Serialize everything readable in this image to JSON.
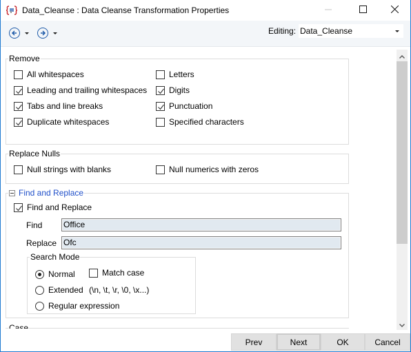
{
  "window": {
    "title": "Data_Cleanse : Data Cleanse Transformation Properties",
    "app_icon": "transform-icon",
    "controls": [
      "minimize-icon",
      "maximize-icon",
      "close-icon"
    ]
  },
  "toolbar": {
    "back_icon": "back-arrow-icon",
    "forward_icon": "forward-arrow-icon",
    "editing_label": "Editing:",
    "editing_value": "Data_Cleanse"
  },
  "remove": {
    "legend": "Remove",
    "items": [
      {
        "label": "All whitespaces",
        "checked": false
      },
      {
        "label": "Leading and trailing whitespaces",
        "checked": true
      },
      {
        "label": "Tabs and line breaks",
        "checked": true
      },
      {
        "label": "Duplicate whitespaces",
        "checked": true
      },
      {
        "label": "Letters",
        "checked": false
      },
      {
        "label": "Digits",
        "checked": true
      },
      {
        "label": "Punctuation",
        "checked": true
      },
      {
        "label": "Specified characters",
        "checked": false
      }
    ]
  },
  "replace_nulls": {
    "legend": "Replace Nulls",
    "items": [
      {
        "label": "Null strings with blanks",
        "checked": false
      },
      {
        "label": "Null numerics with zeros",
        "checked": false
      }
    ]
  },
  "find_replace": {
    "legend": "Find and Replace",
    "enable_label": "Find and Replace",
    "enable_checked": true,
    "find_label": "Find",
    "find_value": "Office",
    "replace_label": "Replace",
    "replace_value": "Ofc",
    "search_mode": {
      "legend": "Search Mode",
      "options": [
        {
          "label": "Normal",
          "selected": true
        },
        {
          "label": "Extended",
          "selected": false
        },
        {
          "label": "Regular expression",
          "selected": false
        }
      ],
      "match_case_label": "Match case",
      "match_case_checked": false,
      "extended_hint": "(\\n, \\t, \\r, \\0, \\x...)"
    }
  },
  "case": {
    "legend": "Case"
  },
  "footer": {
    "prev": "Prev",
    "next": "Next",
    "ok": "OK",
    "cancel": "Cancel"
  }
}
